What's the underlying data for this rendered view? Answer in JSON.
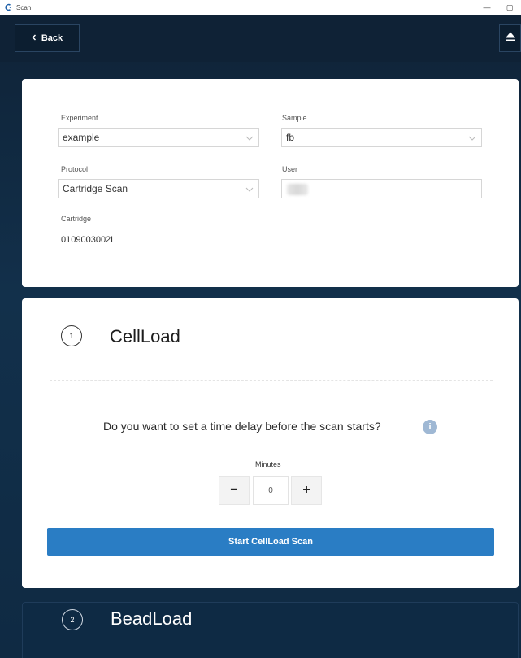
{
  "window": {
    "title": "Scan",
    "minimize_glyph": "—",
    "maximize_glyph": "▢"
  },
  "nav": {
    "back_label": "Back",
    "eject_icon": "eject-icon"
  },
  "form": {
    "experiment_label": "Experiment",
    "experiment_value": "example",
    "sample_label": "Sample",
    "sample_value": "fb",
    "protocol_label": "Protocol",
    "protocol_value": "Cartridge Scan",
    "user_label": "User",
    "user_value": "",
    "cartridge_label": "Cartridge",
    "cartridge_value": "0109003002L"
  },
  "step1": {
    "number": "1",
    "title": "CellLoad",
    "question": "Do you want to set a time delay before the scan starts?",
    "info_glyph": "i",
    "minutes_label": "Minutes",
    "minus_label": "−",
    "plus_label": "+",
    "minutes_value": "0",
    "start_label": "Start CellLoad Scan"
  },
  "step2": {
    "number": "2",
    "title": "BeadLoad"
  },
  "colors": {
    "accent": "#2a7dc4",
    "background": "#0f2236"
  }
}
